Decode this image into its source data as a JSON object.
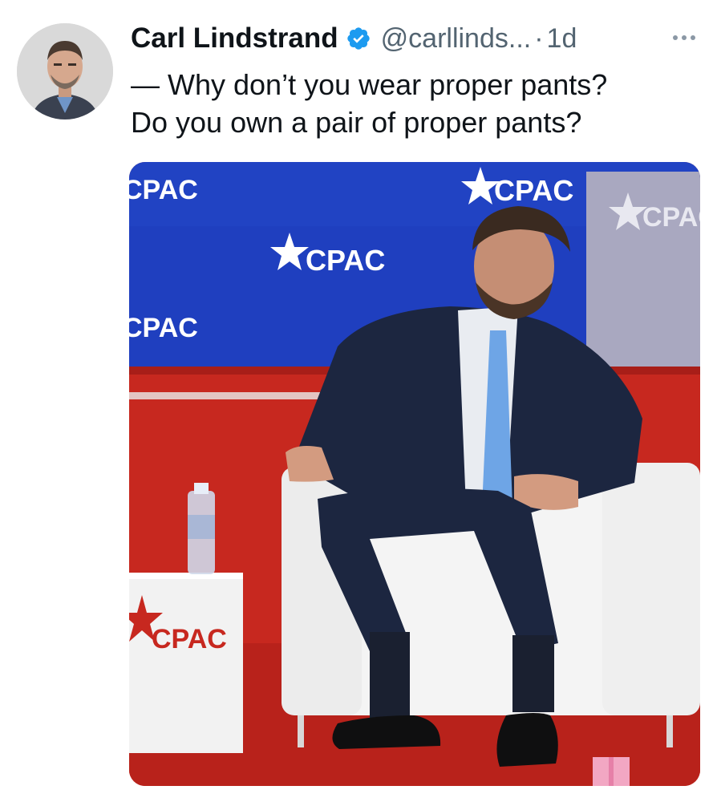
{
  "author": {
    "name": "Carl Lindstrand",
    "handle": "@carllinds...",
    "separator": "·",
    "time": "1d",
    "verified": true,
    "avatar_icon": "profile-photo-avatar"
  },
  "tweet": {
    "lines": [
      "— Why don’t you wear proper pants?",
      "Do you own a pair of proper pants?"
    ]
  },
  "more_icon": "more-options-icon",
  "media": {
    "logo_text": "CPAC",
    "colors": {
      "backdrop_blue": "#1f3fbf",
      "stage_red": "#c7281f",
      "chair_white": "#f4f4f4",
      "suit_navy": "#1c2640",
      "tie_blue": "#6ea5e6"
    }
  },
  "colors": {
    "verified_blue": "#1d9bf0",
    "text_primary": "#0f1419",
    "text_secondary": "#536471"
  }
}
